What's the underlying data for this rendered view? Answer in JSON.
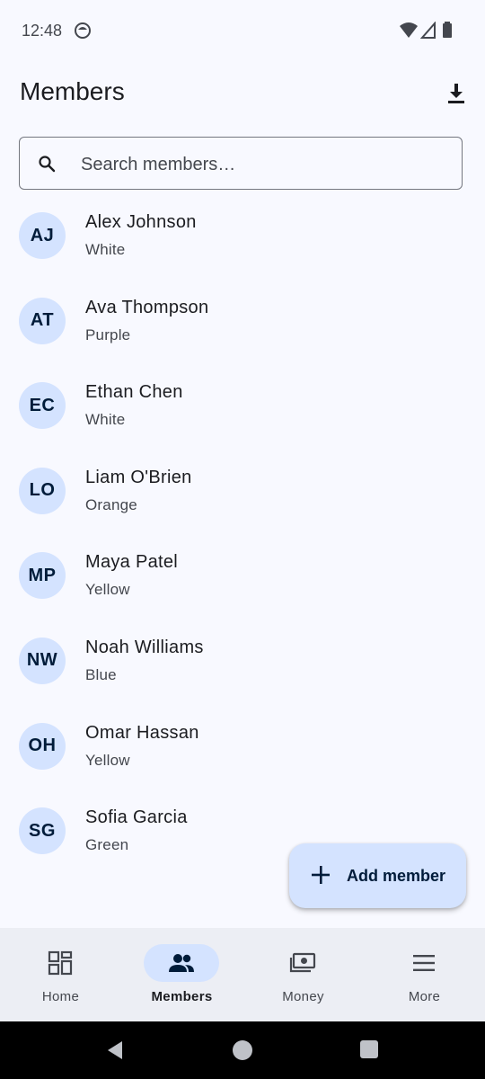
{
  "status_bar": {
    "time": "12:48",
    "icons": [
      "notification-face-icon",
      "wifi-icon",
      "signal-icon",
      "battery-icon"
    ]
  },
  "header": {
    "title": "Members",
    "download_icon": "download-icon"
  },
  "search": {
    "placeholder": "Search members…",
    "value": "",
    "icon": "search-icon"
  },
  "members": [
    {
      "initials": "AJ",
      "name": "Alex Johnson",
      "belt": "White"
    },
    {
      "initials": "AT",
      "name": "Ava Thompson",
      "belt": "Purple"
    },
    {
      "initials": "EC",
      "name": "Ethan Chen",
      "belt": "White"
    },
    {
      "initials": "LO",
      "name": "Liam O'Brien",
      "belt": "Orange"
    },
    {
      "initials": "MP",
      "name": "Maya Patel",
      "belt": "Yellow"
    },
    {
      "initials": "NW",
      "name": "Noah Williams",
      "belt": "Blue"
    },
    {
      "initials": "OH",
      "name": "Omar Hassan",
      "belt": "Yellow"
    },
    {
      "initials": "SG",
      "name": "Sofia Garcia",
      "belt": "Green"
    }
  ],
  "fab": {
    "label": "Add member",
    "icon": "plus-icon"
  },
  "nav": {
    "items": [
      {
        "label": "Home",
        "icon": "dashboard-icon",
        "active": false
      },
      {
        "label": "Members",
        "icon": "people-icon",
        "active": true
      },
      {
        "label": "Money",
        "icon": "money-icon",
        "active": false
      },
      {
        "label": "More",
        "icon": "menu-icon",
        "active": false
      }
    ]
  },
  "system_nav": {
    "icons": [
      "back-icon",
      "home-icon",
      "recents-icon"
    ]
  },
  "colors": {
    "background": "#f8f9ff",
    "accent_container": "#d4e3ff",
    "on_accent_container": "#001c3a",
    "nav_background": "#eceef4",
    "text_primary": "#1b1c20",
    "text_secondary": "#44474e"
  }
}
